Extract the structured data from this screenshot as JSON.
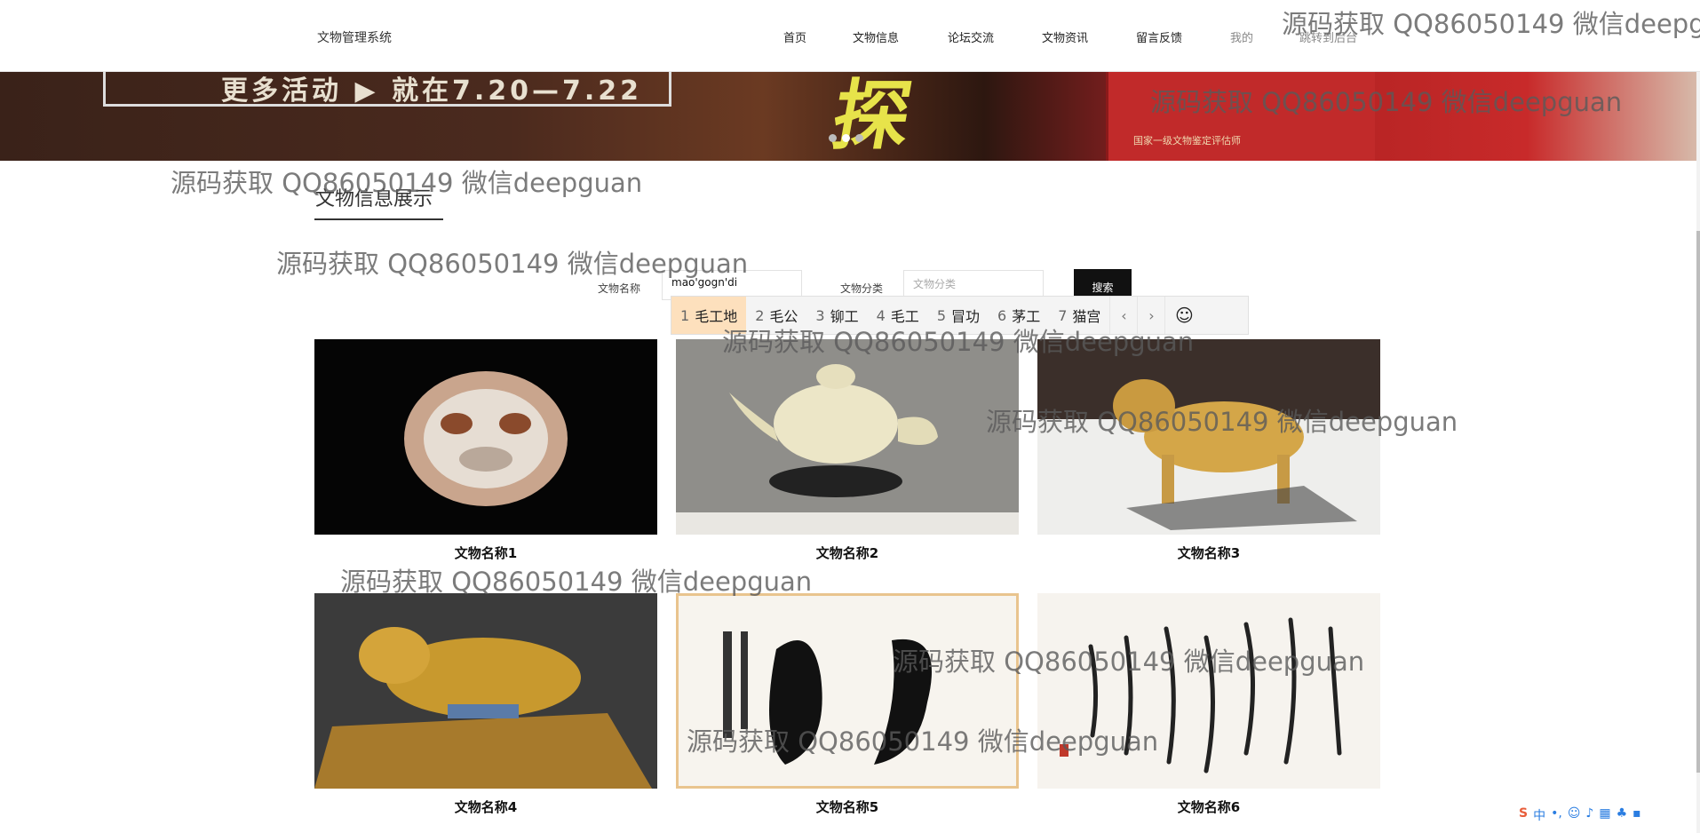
{
  "header": {
    "brand": "文物管理系统",
    "nav": [
      {
        "label": "首页"
      },
      {
        "label": "文物信息"
      },
      {
        "label": "论坛交流"
      },
      {
        "label": "文物资讯"
      },
      {
        "label": "留言反馈"
      },
      {
        "label": "我的"
      },
      {
        "label": "跳转到后台"
      }
    ]
  },
  "banner": {
    "left_text": "更多活动 ▶ 就在7.20—7.22",
    "big_char": "探",
    "plate_text": "国家一级文物鉴定评估师",
    "slide_count": 3,
    "active_slide": 1
  },
  "section": {
    "title": "文物信息展示"
  },
  "search": {
    "name_label": "文物名称",
    "name_value": "mao'gogn'di",
    "category_label": "文物分类",
    "category_placeholder": "文物分类",
    "button_label": "搜索"
  },
  "ime": {
    "candidates": [
      {
        "index": "1",
        "text": "毛工地"
      },
      {
        "index": "2",
        "text": "毛公"
      },
      {
        "index": "3",
        "text": "铆工"
      },
      {
        "index": "4",
        "text": "毛工"
      },
      {
        "index": "5",
        "text": "冒功"
      },
      {
        "index": "6",
        "text": "茅工"
      },
      {
        "index": "7",
        "text": "猫宫"
      }
    ],
    "prev": "‹",
    "next": "›",
    "emoji": "☺"
  },
  "items": [
    {
      "name": "文物名称1"
    },
    {
      "name": "文物名称2"
    },
    {
      "name": "文物名称3"
    },
    {
      "name": "文物名称4"
    },
    {
      "name": "文物名称5"
    },
    {
      "name": "文物名称6"
    }
  ],
  "watermark": "源码获取 QQ86050149 微信deepguan",
  "tray": {
    "ime_logo": "S",
    "ime_mode": "中"
  }
}
